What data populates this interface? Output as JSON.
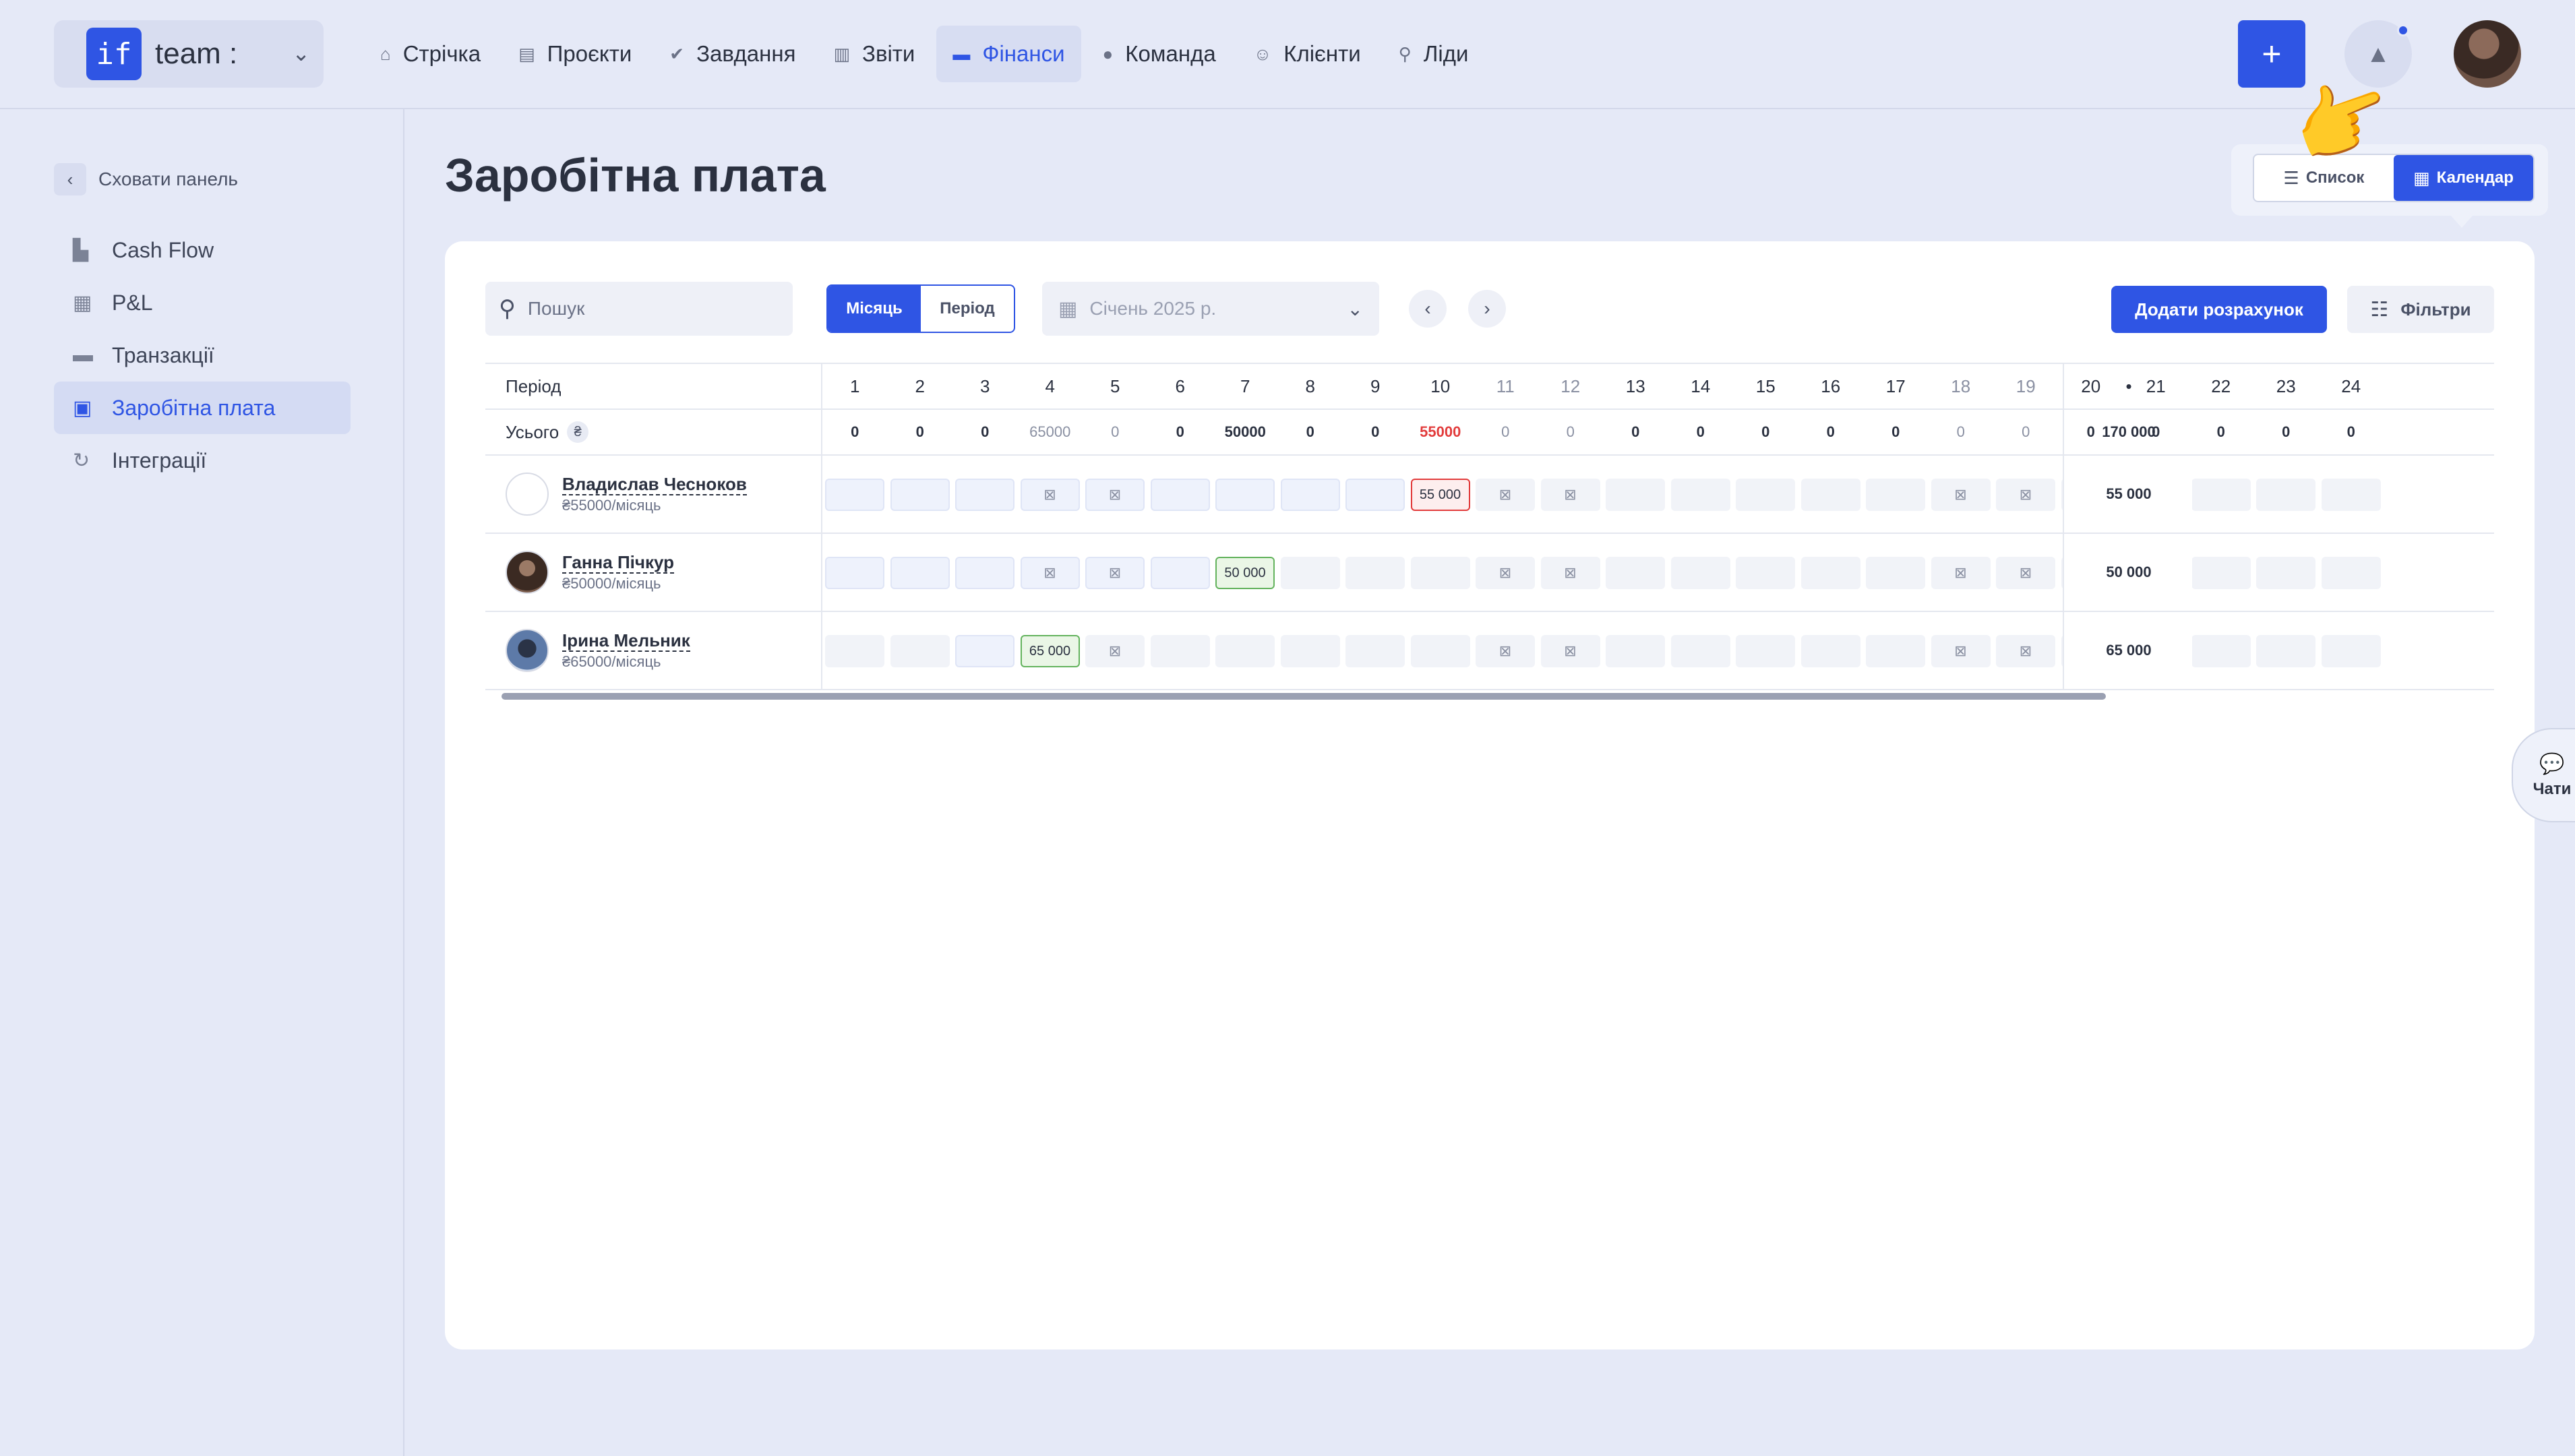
{
  "brand": {
    "logo": "if",
    "name": "team :",
    "chevron": "⌄"
  },
  "nav": [
    {
      "icon": "⌂",
      "label": "Стрічка",
      "name": "nav-feed"
    },
    {
      "icon": "▤",
      "label": "Проєкти",
      "name": "nav-projects"
    },
    {
      "icon": "✔",
      "label": "Завдання",
      "name": "nav-tasks"
    },
    {
      "icon": "▥",
      "label": "Звіти",
      "name": "nav-reports"
    },
    {
      "icon": "▬",
      "label": "Фінанси",
      "name": "nav-finance",
      "active": true
    },
    {
      "icon": "●",
      "label": "Команда",
      "name": "nav-team"
    },
    {
      "icon": "☺",
      "label": "Клієнти",
      "name": "nav-clients"
    },
    {
      "icon": "⚲",
      "label": "Ліди",
      "name": "nav-leads"
    }
  ],
  "header_actions": {
    "plus": "+",
    "bell": "🔔"
  },
  "sidebar": {
    "hide_label": "Сховати панель",
    "items": [
      {
        "icon": "▙",
        "label": "Cash Flow"
      },
      {
        "icon": "▦",
        "label": "P&L"
      },
      {
        "icon": "▬",
        "label": "Транзакції"
      },
      {
        "icon": "▣",
        "label": "Заробітна плата",
        "active": true
      },
      {
        "icon": "↻",
        "label": "Інтеграції"
      }
    ]
  },
  "page": {
    "title": "Заробітна плата"
  },
  "view_toggle": {
    "list_label": "Список",
    "calendar_label": "Календар",
    "active": "calendar"
  },
  "toolbar": {
    "search_placeholder": "Пошук",
    "seg_month": "Місяць",
    "seg_period": "Період",
    "date_value": "Січень 2025 р.",
    "prev": "‹",
    "next": "›",
    "add_label": "Додати розрахунок",
    "filters_label": "Фільтри"
  },
  "table": {
    "period_label": "Період",
    "total_label": "Усього",
    "total_currency": "₴",
    "days": [
      "1",
      "2",
      "3",
      "4",
      "5",
      "6",
      "7",
      "8",
      "9",
      "10",
      "11",
      "12",
      "13",
      "14",
      "15",
      "16",
      "17",
      "18",
      "19",
      "20",
      "21",
      "22",
      "23",
      "24"
    ],
    "light_days": [
      11,
      12,
      18,
      19
    ],
    "sum_header": "•",
    "totals": [
      "0",
      "0",
      "0",
      "65000",
      "0",
      "0",
      "50000",
      "0",
      "0",
      "55000",
      "0",
      "0",
      "0",
      "0",
      "0",
      "0",
      "0",
      "0",
      "0",
      "0",
      "0",
      "0",
      "0",
      "0"
    ],
    "totals_light": [
      4,
      5,
      11,
      12,
      18,
      19
    ],
    "totals_red": [
      10
    ],
    "grand_total": "170 000",
    "employees": [
      {
        "name": "Владислав Чесноков",
        "salary": "₴55000/місяць",
        "sum": "55 000",
        "period_days": [
          1,
          9
        ],
        "marker_day": 10,
        "marker_value": "55 000",
        "marker_type": "overdue",
        "icon_days": [
          4,
          5,
          11,
          12,
          18,
          19
        ]
      },
      {
        "name": "Ганна Пічкур",
        "salary": "₴50000/місяць",
        "sum": "50 000",
        "period_days": [
          1,
          6
        ],
        "marker_day": 7,
        "marker_value": "50 000",
        "marker_type": "paid",
        "icon_days": [
          4,
          5,
          11,
          12,
          18,
          19
        ]
      },
      {
        "name": "Ірина Мельник",
        "salary": "₴65000/місяць",
        "sum": "65 000",
        "period_days": [
          3,
          3
        ],
        "marker_day": 4,
        "marker_value": "65 000",
        "marker_type": "paid",
        "icon_days": [
          5,
          11,
          12,
          18,
          19
        ]
      }
    ]
  },
  "chat_tab": {
    "label": "Чати",
    "icon": "💬"
  },
  "colors": {
    "accent": "#2f55e4",
    "paid": "#63b35d",
    "overdue": "#e23b3b",
    "background": "#e5e9f7"
  }
}
